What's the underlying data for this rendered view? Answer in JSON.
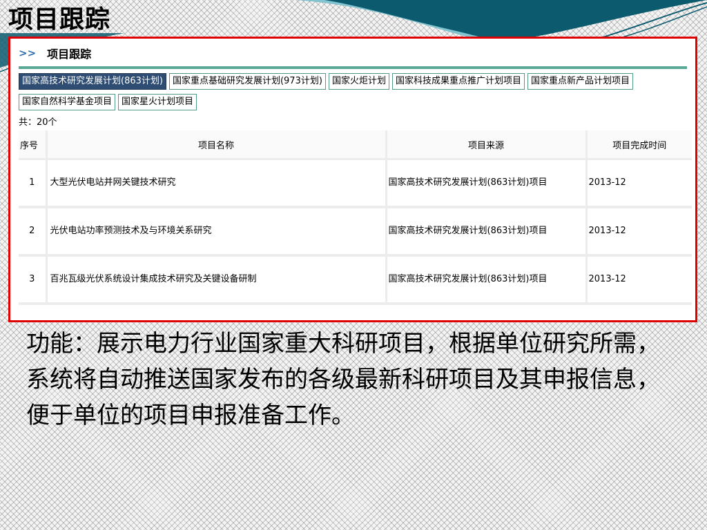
{
  "slide": {
    "title": "项目跟踪",
    "caption": "功能：展示电力行业国家重大科研项目，根据单位研究所需，系统将自动推送国家发布的各级最新科研项目及其申报信息，便于单位的项目申报准备工作。"
  },
  "panel": {
    "chevron": ">>",
    "title": "项目跟踪",
    "count_label": "共：20个"
  },
  "tabs": [
    {
      "label": "国家高技术研究发展计划(863计划)",
      "active": true
    },
    {
      "label": "国家重点基础研究发展计划(973计划)",
      "active": false
    },
    {
      "label": "国家火炬计划",
      "active": false
    },
    {
      "label": "国家科技成果重点推广计划项目",
      "active": false
    },
    {
      "label": "国家重点新产品计划项目",
      "active": false
    },
    {
      "label": "国家自然科学基金项目",
      "active": false
    },
    {
      "label": "国家星火计划项目",
      "active": false
    }
  ],
  "table": {
    "headers": [
      "序号",
      "项目名称",
      "项目来源",
      "项目完成时间"
    ],
    "rows": [
      [
        "1",
        "大型光伏电站并网关键技术研究",
        "国家高技术研究发展计划(863计划)项目",
        "2013-12"
      ],
      [
        "2",
        "光伏电站功率预测技术及与环境关系研究",
        "国家高技术研究发展计划(863计划)项目",
        "2013-12"
      ],
      [
        "3",
        "百兆瓦级光伏系统设计集成技术研究及关键设备研制",
        "国家高技术研究发展计划(863计划)项目",
        "2013-12"
      ]
    ]
  },
  "colors": {
    "frame_border": "#e00000",
    "active_tab": "#2f4d72",
    "tab_border": "#4f9a86",
    "header_rule": "#5aa796",
    "chevron": "#2f6db3",
    "wave_dark": "#0b5a6e",
    "wave_light": "#5aa6b8"
  }
}
